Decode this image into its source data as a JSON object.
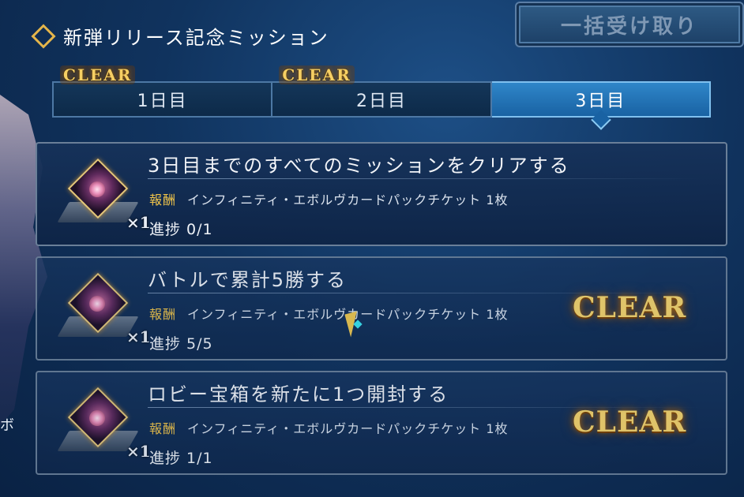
{
  "header": {
    "title": "新弾リリース記念ミッション",
    "bulk_button": "一括受け取り"
  },
  "tabs": [
    {
      "label": "1日目",
      "badge": "CLEAR"
    },
    {
      "label": "2日目",
      "badge": "CLEAR"
    },
    {
      "label": "3日目",
      "badge": ""
    }
  ],
  "missions": [
    {
      "title": "3日目までのすべてのミッションをクリアする",
      "reward_label": "報酬",
      "reward": "インフィニティ・エボルヴカードパックチケット 1枚",
      "quantity": "×1",
      "progress": "進捗 0/1",
      "status": ""
    },
    {
      "title": "バトルで累計5勝する",
      "reward_label": "報酬",
      "reward": "インフィニティ・エボルヴカードパックチケット 1枚",
      "quantity": "×1",
      "progress": "進捗 5/5",
      "status": "CLEAR"
    },
    {
      "title": "ロビー宝箱を新たに1つ開封する",
      "reward_label": "報酬",
      "reward": "インフィニティ・エボルヴカードパックチケット 1枚",
      "quantity": "×1",
      "progress": "進捗 1/1",
      "status": "CLEAR"
    }
  ],
  "background_text": "ボ"
}
